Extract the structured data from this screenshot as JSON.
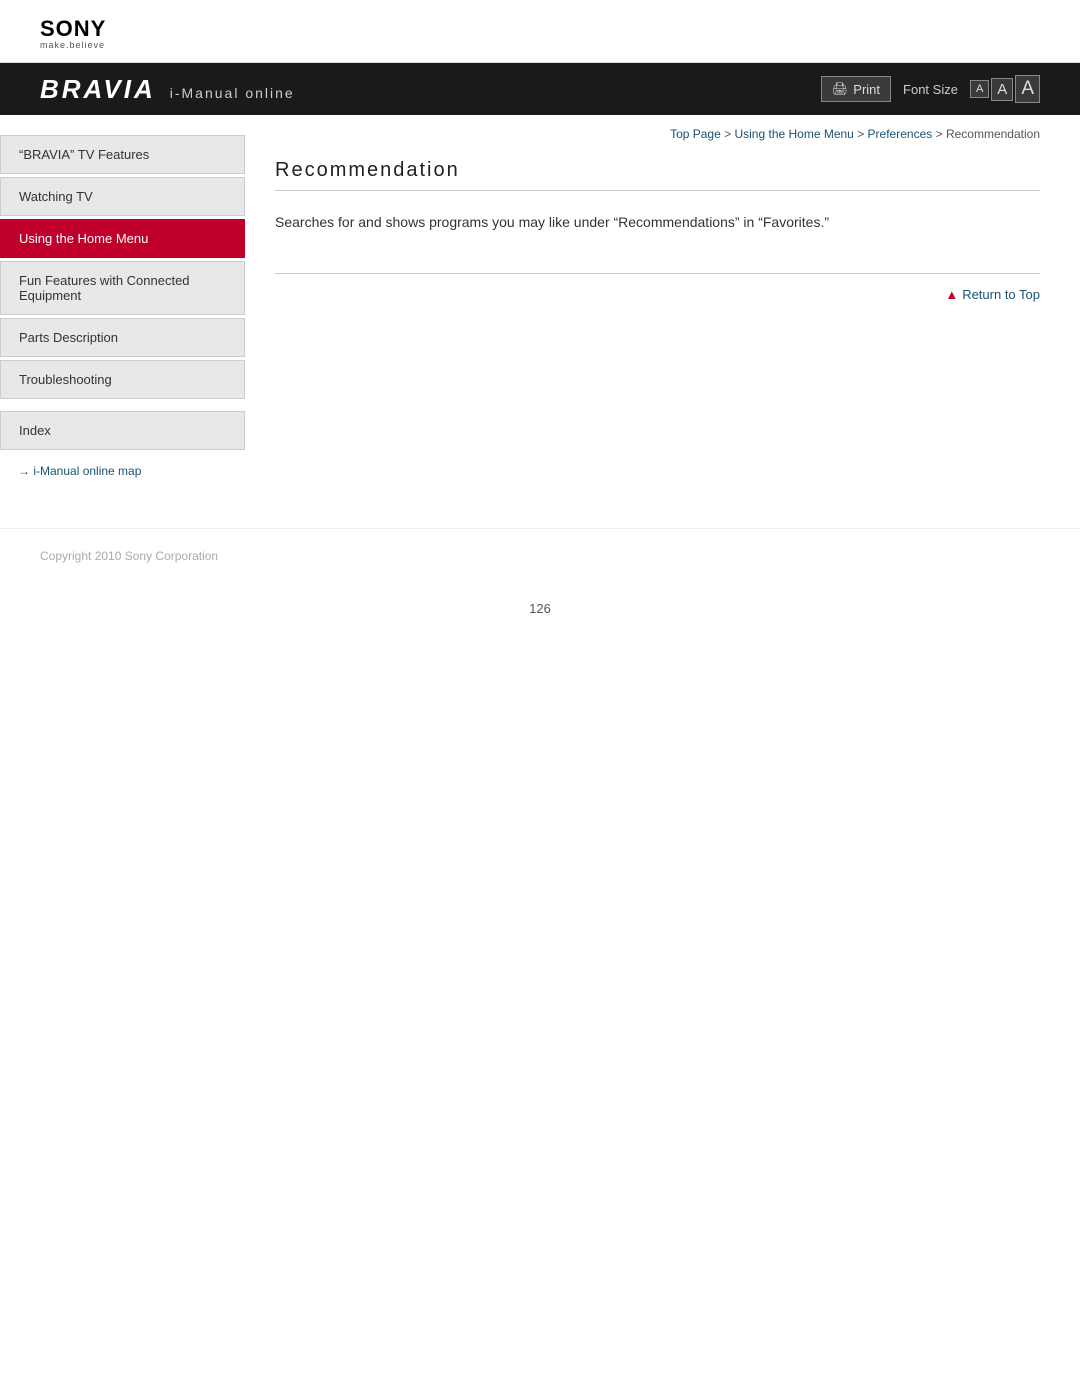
{
  "logo": {
    "brand": "SONY",
    "tagline": "make.believe"
  },
  "navbar": {
    "bravia": "BRAVIA",
    "imanual": "i-Manual online",
    "print_label": "Print",
    "font_size_label": "Font Size",
    "font_size_small": "A",
    "font_size_medium": "A",
    "font_size_large": "A"
  },
  "sidebar": {
    "items": [
      {
        "id": "bravia-features",
        "label": "“BRAVIA” TV Features",
        "active": false
      },
      {
        "id": "watching-tv",
        "label": "Watching TV",
        "active": false
      },
      {
        "id": "using-home-menu",
        "label": "Using the Home Menu",
        "active": true
      },
      {
        "id": "fun-features",
        "label": "Fun Features with Connected Equipment",
        "active": false
      },
      {
        "id": "parts-description",
        "label": "Parts Description",
        "active": false
      },
      {
        "id": "troubleshooting",
        "label": "Troubleshooting",
        "active": false
      }
    ],
    "index_label": "Index",
    "map_link_arrow": "→",
    "map_link_label": "i-Manual online map"
  },
  "breadcrumb": {
    "top_page": "Top Page",
    "using_home_menu": "Using the Home Menu",
    "preferences": "Preferences",
    "current": "Recommendation",
    "separator": ">"
  },
  "content": {
    "page_title": "Recommendation",
    "body_text": "Searches for and shows programs you may like under “Recommendations” in “Favorites.”"
  },
  "return_top": {
    "label": "Return to Top",
    "triangle": "▲"
  },
  "footer": {
    "copyright": "Copyright 2010 Sony Corporation"
  },
  "page_number": "126"
}
